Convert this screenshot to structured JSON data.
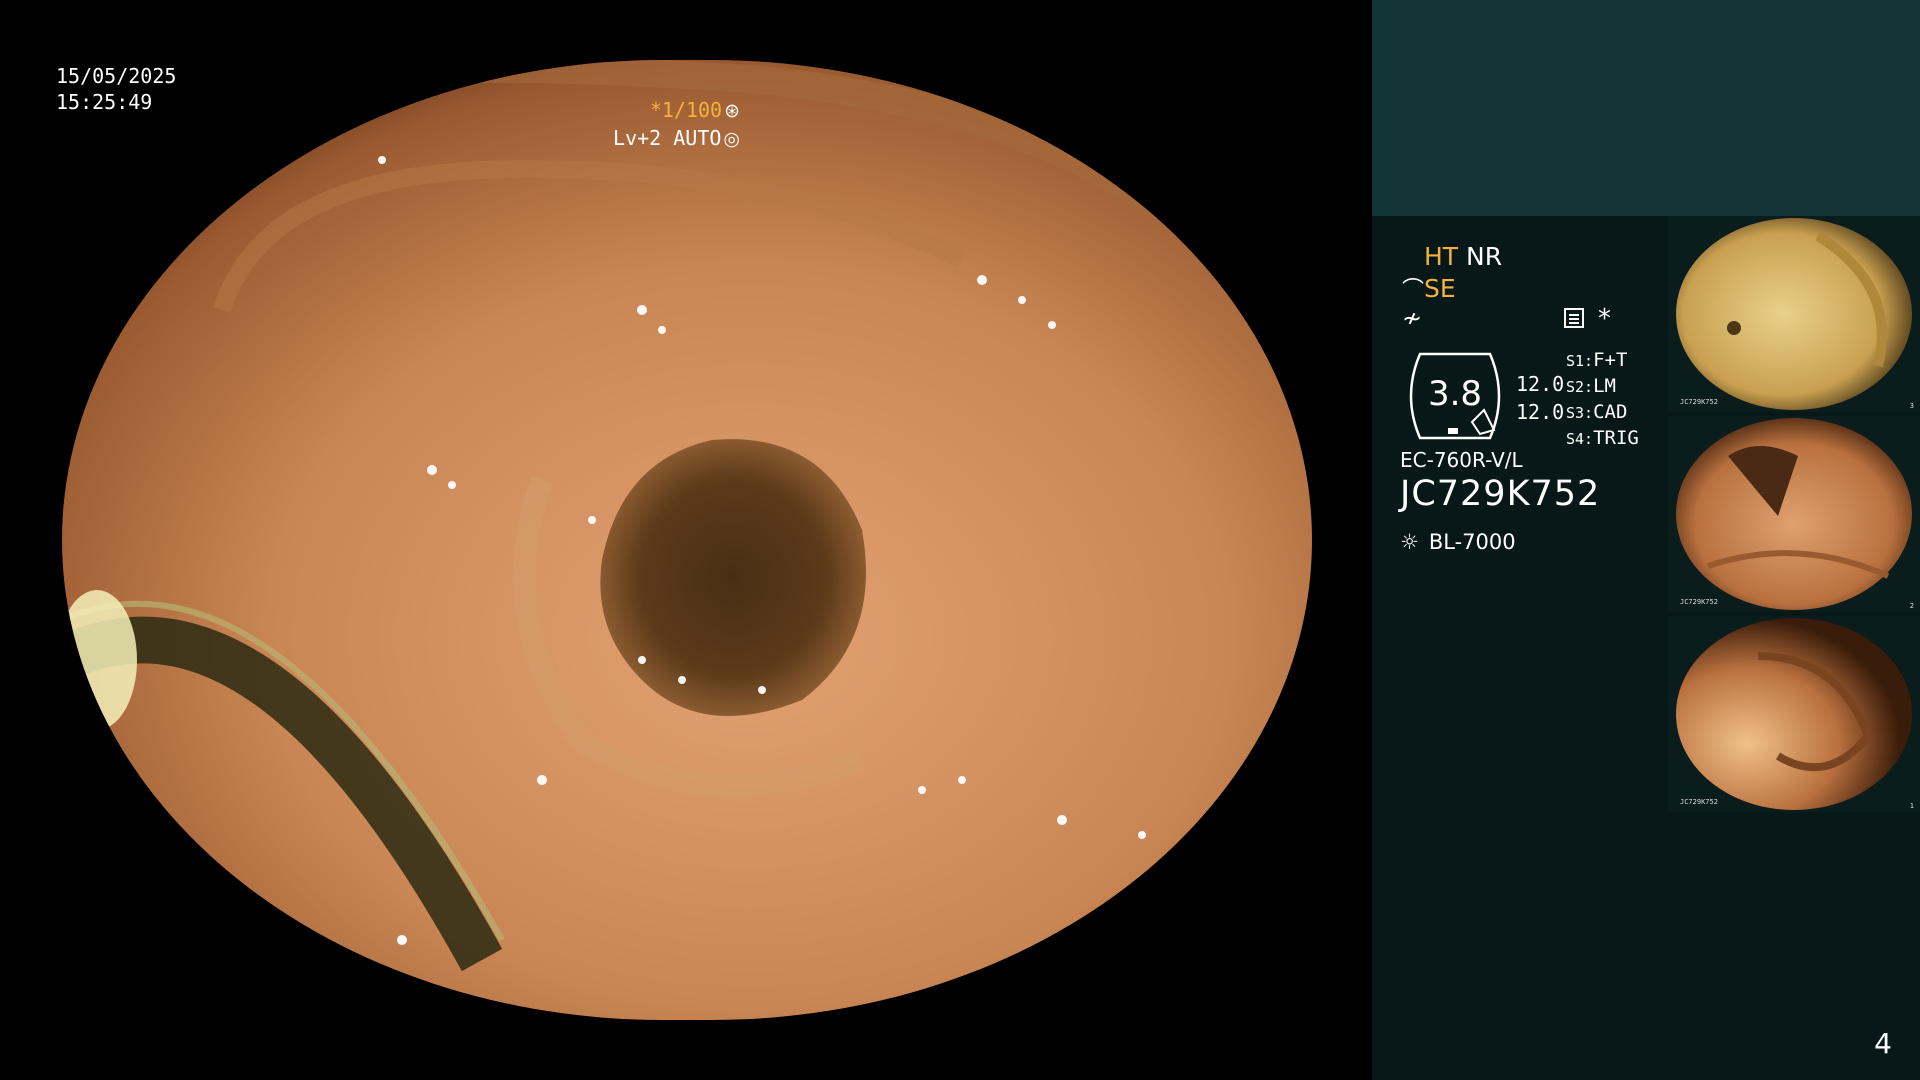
{
  "overlay": {
    "date": "15/05/2025",
    "time": "15:25:49",
    "shutter": "*1/100",
    "level": "Lv+2 AUTO"
  },
  "panel": {
    "ht": "HT",
    "nr": "NR",
    "se": "SE",
    "gauge_value": "3.8",
    "values": [
      "12.0",
      "12.0"
    ],
    "switches": [
      {
        "key": "S1:",
        "value": "F+T"
      },
      {
        "key": "S2:",
        "value": "LM"
      },
      {
        "key": "S3:",
        "value": "CAD"
      },
      {
        "key": "S4:",
        "value": "TRIG"
      }
    ],
    "model": "EC-760R-V/L",
    "serial": "JC729K752",
    "light_source": "BL-7000"
  },
  "thumbnails": [
    {
      "caption": "JC729K752",
      "index": "3"
    },
    {
      "caption": "JC729K752",
      "index": "2"
    },
    {
      "caption": "JC729K752",
      "index": "1"
    }
  ],
  "page_number": "4",
  "colors": {
    "accent": "#f3b23b",
    "panel_bg": "#081818",
    "panel_top": "#123434",
    "tissue": "#c9895a"
  }
}
